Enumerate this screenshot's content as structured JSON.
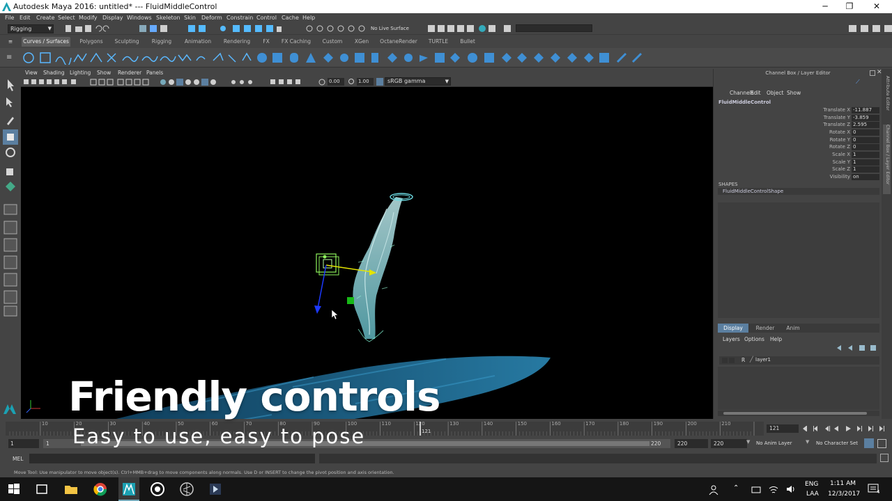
{
  "window": {
    "title": "Autodesk Maya 2016: untitled*   ---   FluidMiddleControl",
    "minimize": "─",
    "maximize": "❐",
    "close": "✕"
  },
  "menubar": [
    "File",
    "Edit",
    "Create",
    "Select",
    "Modify",
    "Display",
    "Windows",
    "Skeleton",
    "Skin",
    "Deform",
    "Constrain",
    "Control",
    "Cache",
    "Help"
  ],
  "statusline": {
    "menuset": "Rigging",
    "live_surface": "No Live Surface"
  },
  "shelf_tabs": [
    "Curves / Surfaces",
    "Polygons",
    "Sculpting",
    "Rigging",
    "Animation",
    "Rendering",
    "FX",
    "FX Caching",
    "Custom",
    "XGen",
    "OctaneRender",
    "TURTLE",
    "Bullet"
  ],
  "shelf_active_tab": "Curves / Surfaces",
  "viewport": {
    "menu": [
      "View",
      "Shading",
      "Lighting",
      "Show",
      "Renderer",
      "Panels"
    ],
    "exposure": "0.00",
    "gamma": "1.00",
    "color_space": "sRGB gamma"
  },
  "channelbox": {
    "header": "Channel Box / Layer Editor",
    "menu": [
      "Channels",
      "Edit",
      "Object",
      "Show"
    ],
    "object_name": "FluidMiddleControl",
    "attributes": [
      {
        "label": "Translate X",
        "value": "-11.887"
      },
      {
        "label": "Translate Y",
        "value": "-3.859"
      },
      {
        "label": "Translate Z",
        "value": "2.595"
      },
      {
        "label": "Rotate X",
        "value": "0"
      },
      {
        "label": "Rotate Y",
        "value": "0"
      },
      {
        "label": "Rotate Z",
        "value": "0"
      },
      {
        "label": "Scale X",
        "value": "1"
      },
      {
        "label": "Scale Y",
        "value": "1"
      },
      {
        "label": "Scale Z",
        "value": "1"
      },
      {
        "label": "Visibility",
        "value": "on"
      }
    ],
    "shapes_header": "SHAPES",
    "shape_name": "FluidMiddleControlShape",
    "layer_tabs": [
      "Display",
      "Render",
      "Anim"
    ],
    "layer_menu": [
      "Layers",
      "Options",
      "Help"
    ],
    "layer_row": {
      "flag": "R",
      "name": "layer1"
    },
    "side_tabs": [
      "Attribute Editor",
      "Channel Box / Layer Editor"
    ]
  },
  "timeline": {
    "ticks": [
      "10",
      "20",
      "30",
      "40",
      "50",
      "60",
      "70",
      "80",
      "90",
      "100",
      "110",
      "120",
      "130",
      "140",
      "150",
      "160",
      "170",
      "180",
      "190",
      "200",
      "210"
    ],
    "current_frame_marker": "121",
    "current_frame": "121",
    "range_start": "1",
    "range_start_inner": "1",
    "range_end_inner": "220",
    "range_end": "220",
    "anim_end": "220",
    "anim_layer": "No Anim Layer",
    "character_set": "No Character Set"
  },
  "cmdline": {
    "label": "MEL"
  },
  "helpline": "Move Tool: Use manipulator to move object(s). Ctrl+MMB+drag to move components along normals. Use D or INSERT to change the pivot position and axis orientation.",
  "taskbar": {
    "language": "ENG",
    "language_sub": "LAA",
    "time": "1:11 AM",
    "date": "12/3/2017",
    "notifications": "4"
  },
  "overlay": {
    "title": "Friendly controls",
    "subtitle": "Easy to use, easy to pose"
  }
}
